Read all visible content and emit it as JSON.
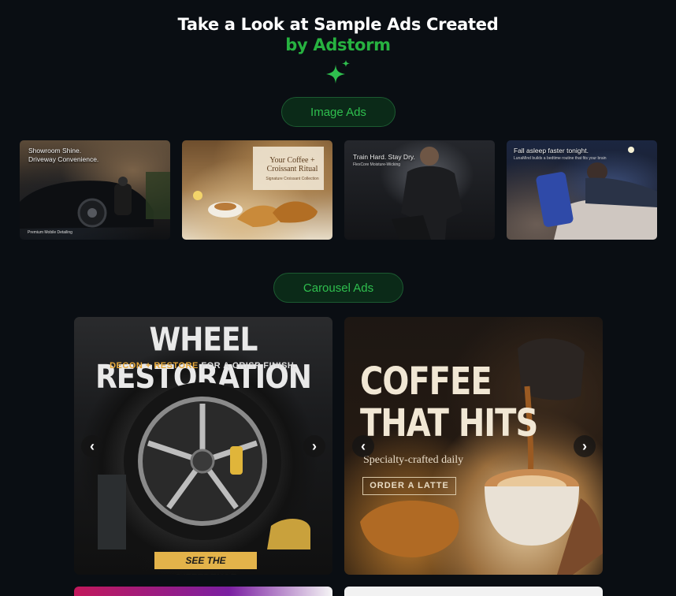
{
  "header": {
    "title": "Take a Look at Sample Ads Created",
    "subtitle": "by Adstorm",
    "accent_color": "#27b240",
    "icon": "sparkle-icon"
  },
  "sections": {
    "image_ads": {
      "label": "Image Ads",
      "items": [
        {
          "caption": "Showroom Shine. Driveway Convenience.",
          "footer": "Premium Mobile Detailing"
        },
        {
          "caption": "Your Coffee + Croissant Ritual",
          "subcaption": "Signature Croissant Collection"
        },
        {
          "caption": "Train Hard. Stay Dry.",
          "subcaption": "FlexCore Moisture-Wicking"
        },
        {
          "caption": "Fall asleep faster tonight.",
          "subcaption": "LunaMind builds a bedtime routine that fits your brain"
        }
      ]
    },
    "carousel_ads": {
      "label": "Carousel Ads",
      "items": [
        {
          "title": "WHEEL RESTORATION",
          "subtitle_highlight": "DECON + RESTORE",
          "subtitle_rest": "FOR A CRISP FINISH.",
          "cta": "SEE THE DIFFERENCE"
        },
        {
          "title_line1": "COFFEE",
          "title_line2": "THAT HITS",
          "subtitle": "Specialty-crafted daily",
          "cta": "ORDER A LATTE"
        }
      ],
      "prev_icon": "‹",
      "next_icon": "›"
    }
  }
}
